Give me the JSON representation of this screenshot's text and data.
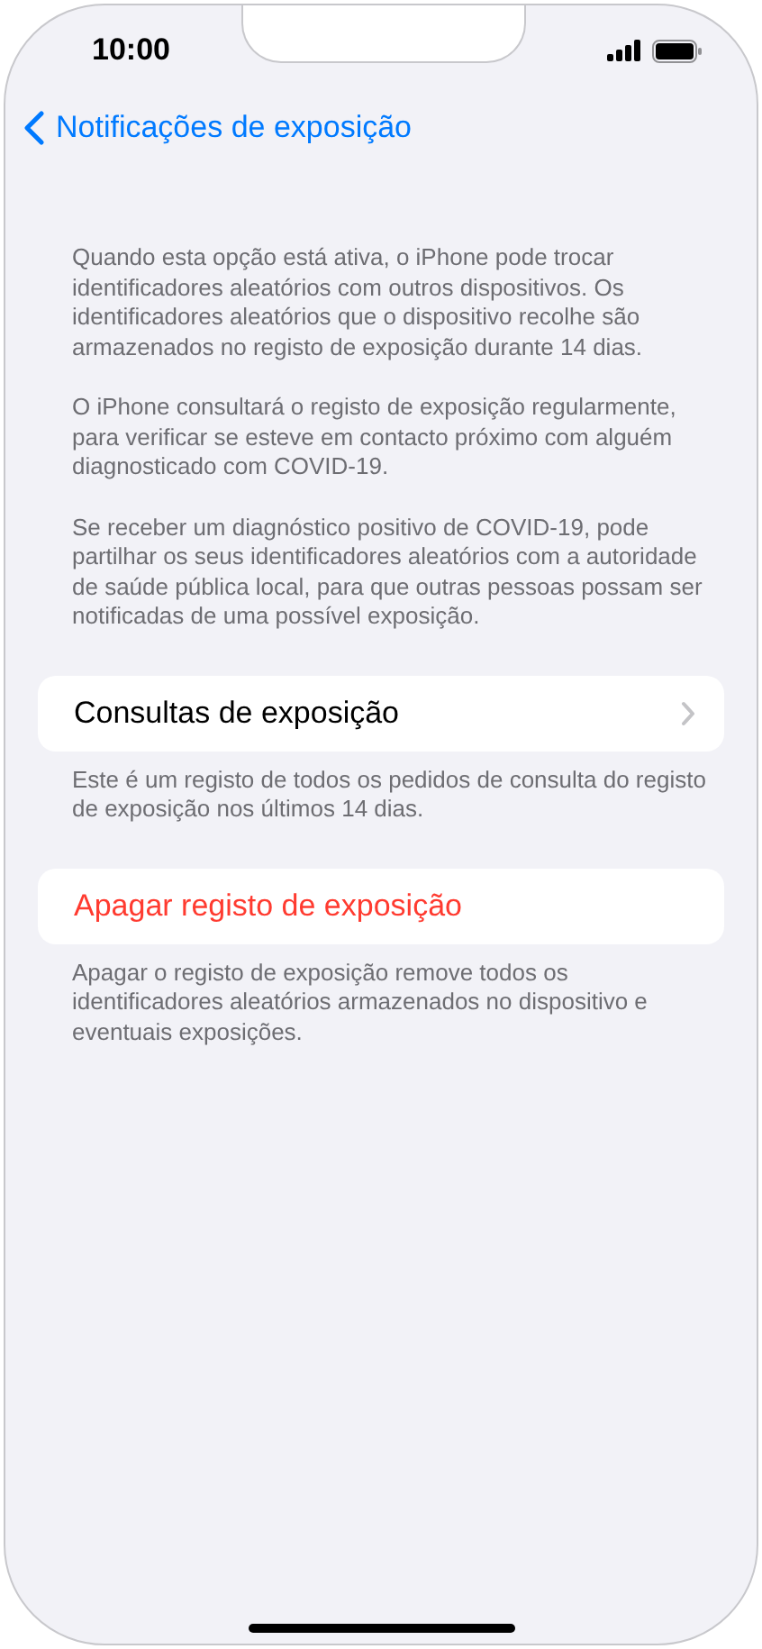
{
  "status_bar": {
    "time": "10:00"
  },
  "nav": {
    "back_label": "Notificações de exposição"
  },
  "intro_paragraphs": [
    "Quando esta opção está ativa, o iPhone pode trocar identificadores aleatórios com outros dispositivos. Os identificadores aleatórios que o dispositivo recolhe são armazenados no registo de exposição durante 14 dias.",
    "O iPhone consultará o registo de exposição regularmente, para verificar se esteve em contacto próximo com alguém diagnosticado com COVID-19.",
    "Se receber um diagnóstico positivo de COVID-19, pode partilhar os seus identificadores aleatórios com a autoridade de saúde pública local, para que outras pessoas possam ser notificadas de uma possível exposição."
  ],
  "sections": [
    {
      "kind": "link",
      "label": "Consultas de exposição",
      "footer": "Este é um registo de todos os pedidos de consulta do registo de exposição nos últimos 14 dias."
    },
    {
      "kind": "destructive",
      "label": "Apagar registo de exposição",
      "footer": "Apagar o registo de exposição remove todos os identificadores aleatórios armazenados no dispositivo e eventuais exposições."
    }
  ]
}
